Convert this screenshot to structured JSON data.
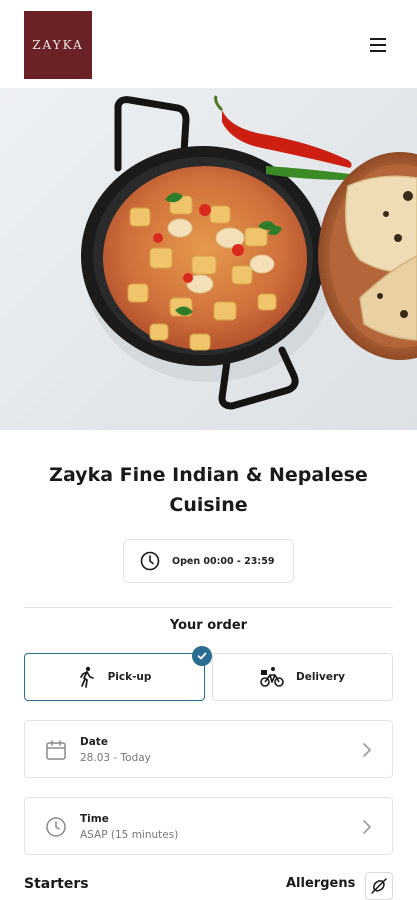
{
  "header": {
    "logo_text": "ZAYKA",
    "menu_icon": "hamburger-menu-icon"
  },
  "hero": {
    "image_subject": "curry-pan-chilies-naan"
  },
  "restaurant": {
    "name": "Zayka Fine Indian & Nepalese Cuisine",
    "hours": "Open 00:00 - 23:59"
  },
  "order": {
    "label": "Your order",
    "options": [
      {
        "label": "Pick-up",
        "icon": "walking-person-icon",
        "selected": true
      },
      {
        "label": "Delivery",
        "icon": "bicycle-courier-icon",
        "selected": false
      }
    ],
    "date": {
      "label": "Date",
      "value": "28.03 - Today"
    },
    "time": {
      "label": "Time",
      "value": "ASAP (15 minutes)"
    }
  },
  "menu": {
    "section_title": "Starters",
    "allergens_label": "Allergens"
  },
  "colors": {
    "brand": "#6b2226",
    "accent": "#2a6d90"
  }
}
